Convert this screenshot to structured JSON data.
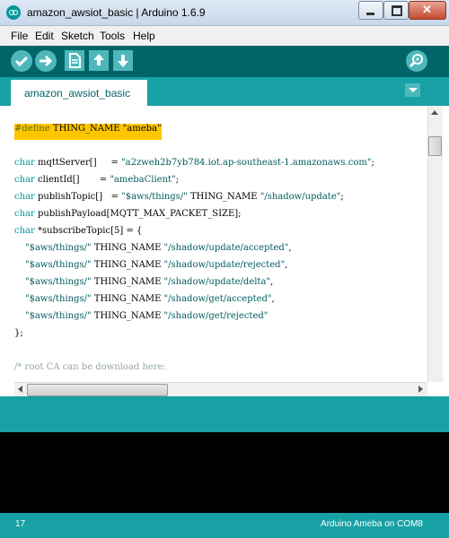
{
  "window": {
    "title": "amazon_awsiot_basic | Arduino 1.6.9"
  },
  "menu": {
    "items": [
      "File",
      "Edit",
      "Sketch",
      "Tools",
      "Help"
    ]
  },
  "toolbar": {
    "buttons": [
      "verify-icon",
      "upload-icon",
      "new-icon",
      "open-icon",
      "save-icon"
    ],
    "serial_monitor_icon": "magnifier-icon"
  },
  "tab": {
    "label": "amazon_awsiot_basic"
  },
  "editor": {
    "lines": {
      "l1": {
        "directive": "#define",
        "rest": " THING_NAME \"ameba\""
      },
      "l3": {
        "kw": "char",
        "rest": " mqttServer[]     = ",
        "str": "\"a2zweh2b7yb784.iot.ap-southeast-1.amazonaws.com\"",
        "end": ";"
      },
      "l4": {
        "kw": "char",
        "rest": " clientId[]       = ",
        "str": "\"amebaClient\"",
        "end": ";"
      },
      "l5": {
        "kw": "char",
        "rest": " publishTopic[]   = ",
        "str": "\"$aws/things/\"",
        "mid": " THING_NAME ",
        "str2": "\"/shadow/update\"",
        "end": ";"
      },
      "l6": {
        "kw": "char",
        "rest": " publishPayload[MQTT_MAX_PACKET_SIZE];"
      },
      "l7": {
        "kw": "char",
        "rest": " *subscribeTopic[5] = {"
      },
      "l8": {
        "str": "\"$aws/things/\"",
        "mid": " THING_NAME ",
        "str2": "\"/shadow/update/accepted\"",
        "end": ","
      },
      "l9": {
        "str": "\"$aws/things/\"",
        "mid": " THING_NAME ",
        "str2": "\"/shadow/update/rejected\"",
        "end": ","
      },
      "l10": {
        "str": "\"$aws/things/\"",
        "mid": " THING_NAME ",
        "str2": "\"/shadow/update/delta\"",
        "end": ","
      },
      "l11": {
        "str": "\"$aws/things/\"",
        "mid": " THING_NAME ",
        "str2": "\"/shadow/get/accepted\"",
        "end": ","
      },
      "l12": {
        "str": "\"$aws/things/\"",
        "mid": " THING_NAME ",
        "str2": "\"/shadow/get/rejected\""
      },
      "l13": {
        "text": "};"
      },
      "l15": {
        "comment": "/* root CA can be download here:"
      }
    }
  },
  "status": {
    "line_number": "17",
    "board": "Arduino Ameba on COM8"
  },
  "colors": {
    "teal_dark": "#006468",
    "teal": "#17a1a5",
    "button": "#4db7bb",
    "highlight": "#ffc600"
  }
}
